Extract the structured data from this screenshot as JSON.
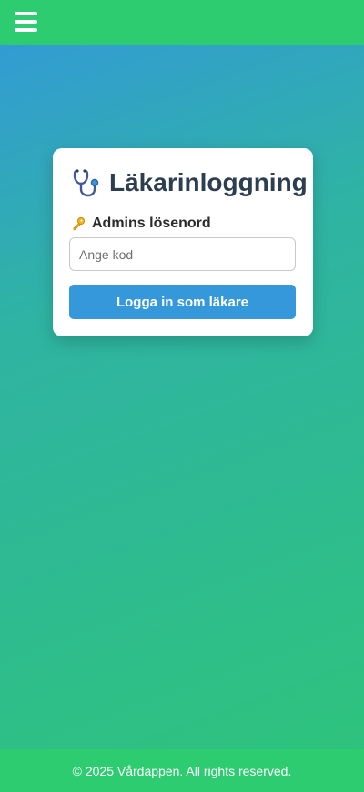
{
  "header": {
    "menu_icon": "hamburger-menu-icon"
  },
  "login_card": {
    "title_icon": "stethoscope-icon",
    "title": "Läkarinloggning",
    "password_icon": "key-icon",
    "password_label": "Admins lösenord",
    "password_value": "",
    "password_placeholder": "Ange kod",
    "submit_label": "Logga in som läkare"
  },
  "footer": {
    "text": "© 2025 Vårdappen. All rights reserved."
  },
  "colors": {
    "topbar": "#2ecc71",
    "gradient_start": "#3398db",
    "gradient_end": "#2ec47a",
    "button": "#3498db",
    "title_text": "#2c3e50"
  }
}
